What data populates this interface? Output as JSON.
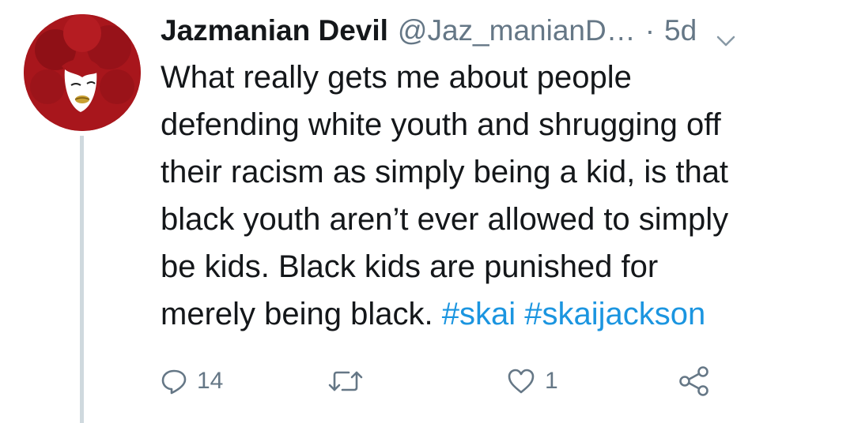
{
  "tweet": {
    "display_name": "Jazmanian Devil",
    "handle": "@Jaz_manianD…",
    "separator": "·",
    "time": "5d",
    "text_lines": [
      "What really gets me about people",
      "defending white youth and shrugging off",
      "their racism as simply being a kid, is that",
      "black youth aren’t ever allowed to simply",
      "be kids. Black kids are punished for"
    ],
    "last_line_text": "merely being black.",
    "hashtags": [
      "#skai",
      "#skaijackson"
    ],
    "reply_count": "14",
    "retweet_count": "",
    "like_count": "1"
  },
  "colors": {
    "text": "#14171a",
    "secondary": "#657786",
    "link": "#1b95e0",
    "avatar_red": "#a8161c",
    "thread_line": "#cfd9de"
  },
  "icons": {
    "caret": "chevron-down-icon",
    "reply": "reply-icon",
    "retweet": "retweet-icon",
    "like": "heart-icon",
    "share": "share-icon"
  }
}
